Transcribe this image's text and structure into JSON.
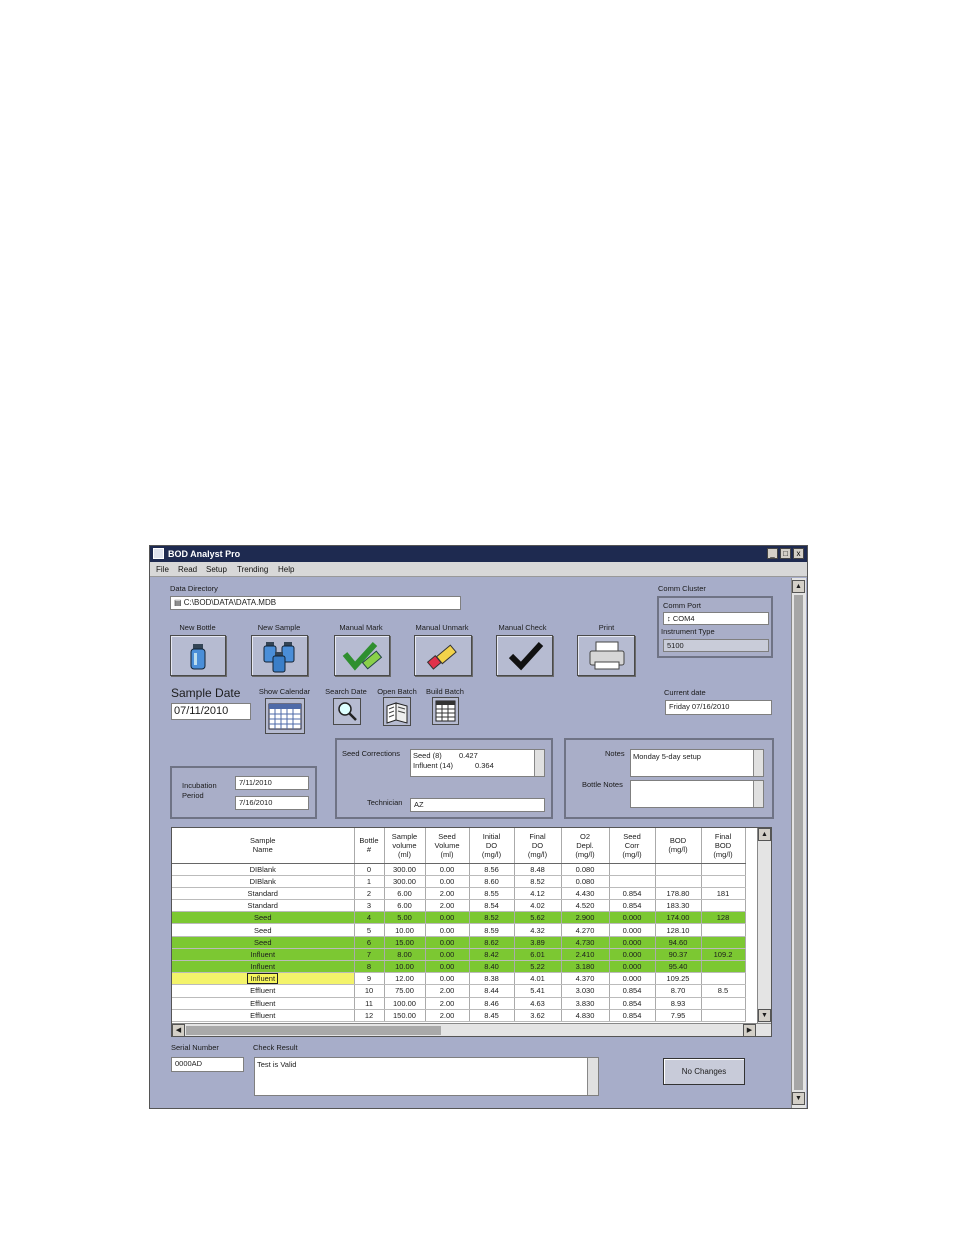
{
  "window": {
    "title": "BOD Analyst Pro",
    "min": "_",
    "max": "□",
    "close": "x"
  },
  "menu": [
    "File",
    "Read",
    "Setup",
    "Trending",
    "Help"
  ],
  "data_directory": {
    "label": "Data Directory",
    "value": "C:\\BOD\\DATA\\DATA.MDB"
  },
  "comm": {
    "cluster_label": "Comm Cluster",
    "port_label": "Comm Port",
    "port_value": "COM4",
    "instrument_label": "Instrument Type",
    "instrument_value": "5100"
  },
  "toolbar": {
    "new_bottle": "New Bottle",
    "new_sample": "New Sample",
    "manual_mark": "Manual Mark",
    "manual_unmark": "Manual Unmark",
    "manual_check": "Manual Check",
    "print": "Print"
  },
  "sample_date": {
    "label": "Sample Date",
    "value": "07/11/2010"
  },
  "date_tools": {
    "show_calendar": "Show Calendar",
    "search_date": "Search Date",
    "open_batch": "Open Batch",
    "build_batch": "Build Batch"
  },
  "current_date": {
    "label": "Current date",
    "value": "Friday 07/16/2010"
  },
  "incubation": {
    "label1": "Incubation",
    "label2": "Period",
    "start": "7/11/2010",
    "end": "7/16/2010"
  },
  "seed": {
    "label": "Seed Corrections",
    "line1_name": "Seed (8)",
    "line1_val": "0.427",
    "line2_name": "Influent (14)",
    "line2_val": "0.364",
    "technician_label": "Technician",
    "technician_value": "AZ"
  },
  "notes": {
    "label": "Notes",
    "value": "Monday 5-day setup",
    "bottle_label": "Bottle Notes",
    "bottle_value": ""
  },
  "table": {
    "headers": [
      [
        "Sample",
        "Name"
      ],
      [
        "Bottle",
        "#"
      ],
      [
        "Sample",
        "volume",
        "(ml)"
      ],
      [
        "Seed",
        "Volume",
        "(ml)"
      ],
      [
        "Initial",
        "DO",
        "(mg/l)"
      ],
      [
        "Final",
        "DO",
        "(mg/l)"
      ],
      [
        "O2",
        "Depl.",
        "(mg/l)"
      ],
      [
        "Seed",
        "Corr",
        "(mg/l)"
      ],
      [
        "BOD",
        "(mg/l)"
      ],
      [
        "Final",
        "BOD",
        "(mg/l)"
      ]
    ],
    "rows": [
      [
        "DIBlank",
        "0",
        "300.00",
        "0.00",
        "8.56",
        "8.48",
        "0.080",
        "",
        "",
        ""
      ],
      [
        "DIBlank",
        "1",
        "300.00",
        "0.00",
        "8.60",
        "8.52",
        "0.080",
        "",
        "",
        ""
      ],
      [
        "Standard",
        "2",
        "6.00",
        "2.00",
        "8.55",
        "4.12",
        "4.430",
        "0.854",
        "178.80",
        "181"
      ],
      [
        "Standard",
        "3",
        "6.00",
        "2.00",
        "8.54",
        "4.02",
        "4.520",
        "0.854",
        "183.30",
        ""
      ],
      [
        "Seed",
        "4",
        "5.00",
        "0.00",
        "8.52",
        "5.62",
        "2.900",
        "0.000",
        "174.00",
        "128"
      ],
      [
        "Seed",
        "5",
        "10.00",
        "0.00",
        "8.59",
        "4.32",
        "4.270",
        "0.000",
        "128.10",
        ""
      ],
      [
        "Seed",
        "6",
        "15.00",
        "0.00",
        "8.62",
        "3.89",
        "4.730",
        "0.000",
        "94.60",
        ""
      ],
      [
        "Influent",
        "7",
        "8.00",
        "0.00",
        "8.42",
        "6.01",
        "2.410",
        "0.000",
        "90.37",
        "109.2"
      ],
      [
        "Influent",
        "8",
        "10.00",
        "0.00",
        "8.40",
        "5.22",
        "3.180",
        "0.000",
        "95.40",
        ""
      ],
      [
        "Influent",
        "9",
        "12.00",
        "0.00",
        "8.38",
        "4.01",
        "4.370",
        "0.000",
        "109.25",
        ""
      ],
      [
        "Effluent",
        "10",
        "75.00",
        "2.00",
        "8.44",
        "5.41",
        "3.030",
        "0.854",
        "8.70",
        "8.5"
      ],
      [
        "Effluent",
        "11",
        "100.00",
        "2.00",
        "8.46",
        "4.63",
        "3.830",
        "0.854",
        "8.93",
        ""
      ],
      [
        "Effluent",
        "12",
        "150.00",
        "2.00",
        "8.45",
        "3.62",
        "4.830",
        "0.854",
        "7.95",
        ""
      ]
    ],
    "green_rows": [
      4,
      6,
      7,
      8
    ],
    "selected_row": 9
  },
  "serial": {
    "label": "Serial Number",
    "value": "0000AD"
  },
  "check": {
    "label": "Check Result",
    "value": "Test is Valid"
  },
  "no_changes": "No Changes",
  "colors": {
    "window_bg": "#a7adc9",
    "titlebar": "#1e2a50",
    "green_row": "#7cc832",
    "selected_cell": "#f3f36a"
  }
}
